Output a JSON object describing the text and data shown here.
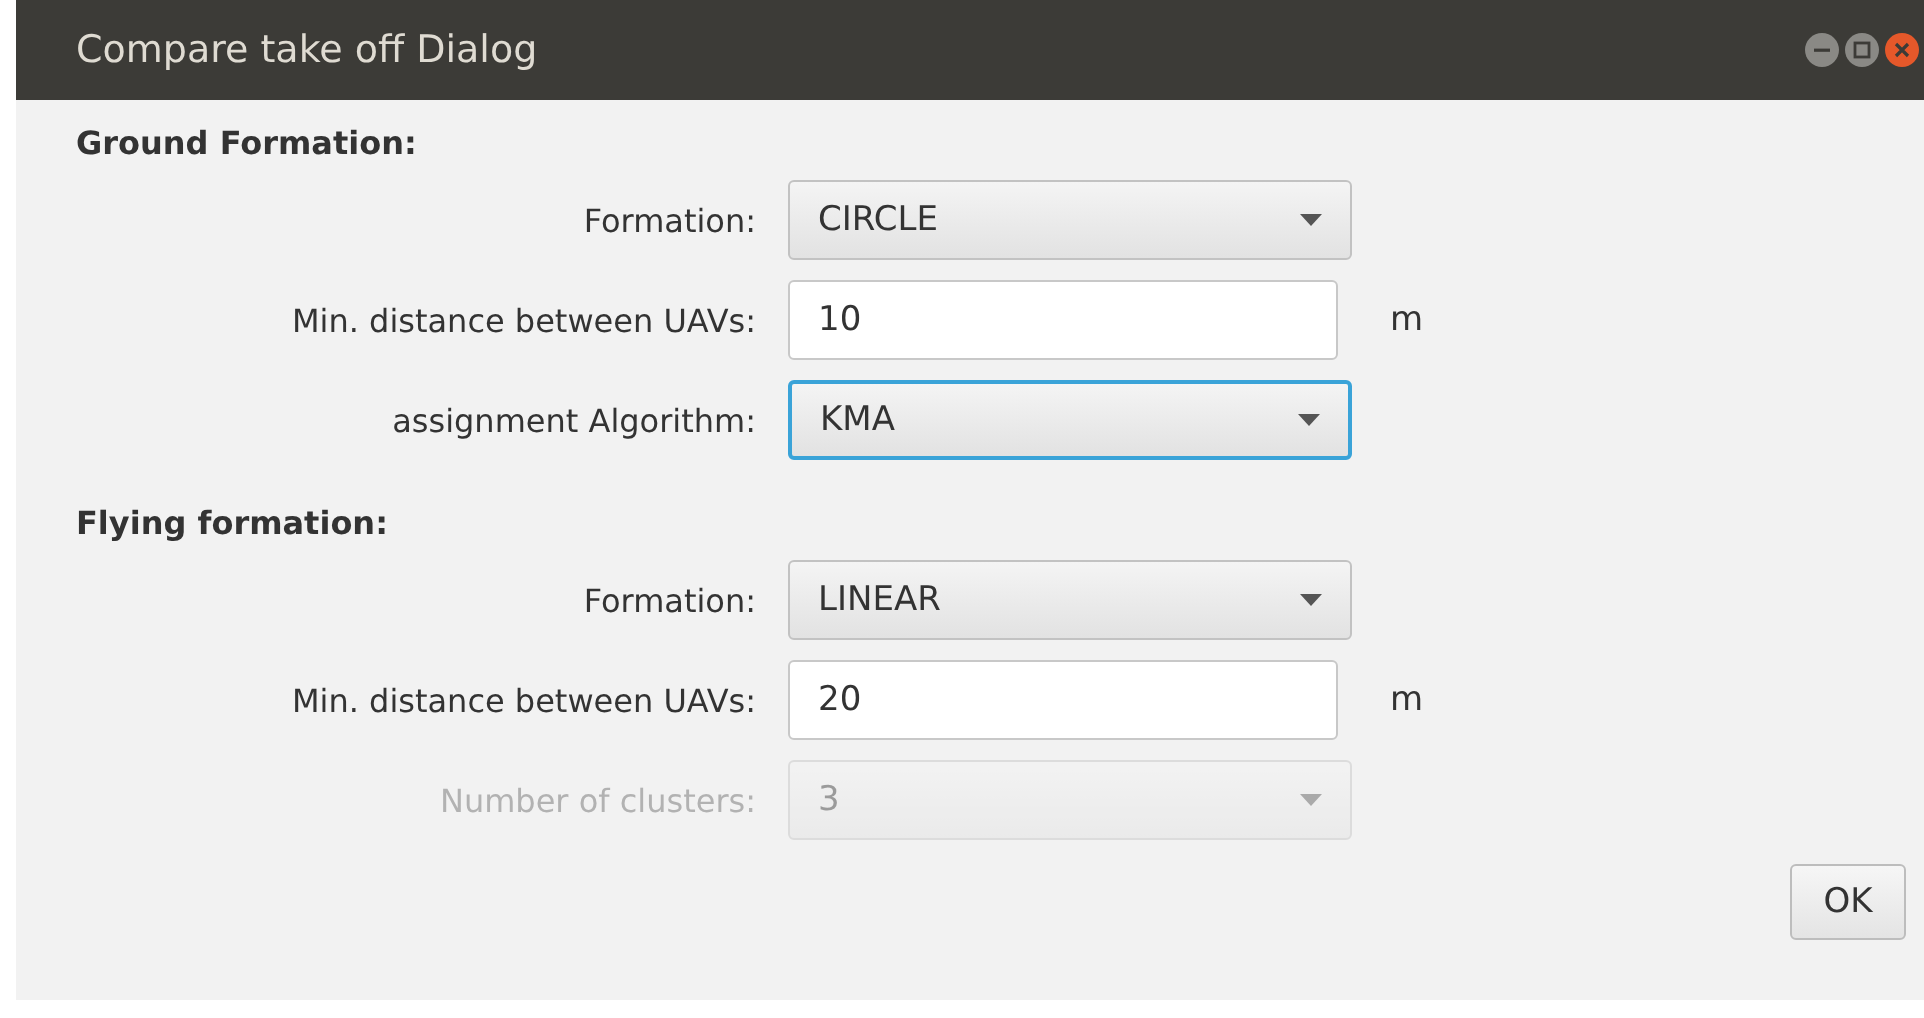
{
  "window": {
    "title": "Compare take off Dialog"
  },
  "sections": [
    {
      "heading": "Ground Formation:",
      "rows": [
        {
          "kind": "combo",
          "label": "Formation:",
          "value": "CIRCLE",
          "focused": false,
          "disabled": false
        },
        {
          "kind": "text",
          "label": "Min. distance between UAVs:",
          "value": "10",
          "unit": "m",
          "focused": false,
          "disabled": false
        },
        {
          "kind": "combo",
          "label": "assignment Algorithm:",
          "value": "KMA",
          "focused": true,
          "disabled": false
        }
      ]
    },
    {
      "heading": "Flying formation:",
      "rows": [
        {
          "kind": "combo",
          "label": "Formation:",
          "value": "LINEAR",
          "focused": false,
          "disabled": false
        },
        {
          "kind": "text",
          "label": "Min. distance between UAVs:",
          "value": "20",
          "unit": "m",
          "focused": false,
          "disabled": false
        },
        {
          "kind": "combo",
          "label": "Number of clusters:",
          "value": "3",
          "focused": false,
          "disabled": true
        }
      ]
    }
  ],
  "buttons": [
    "OK"
  ]
}
